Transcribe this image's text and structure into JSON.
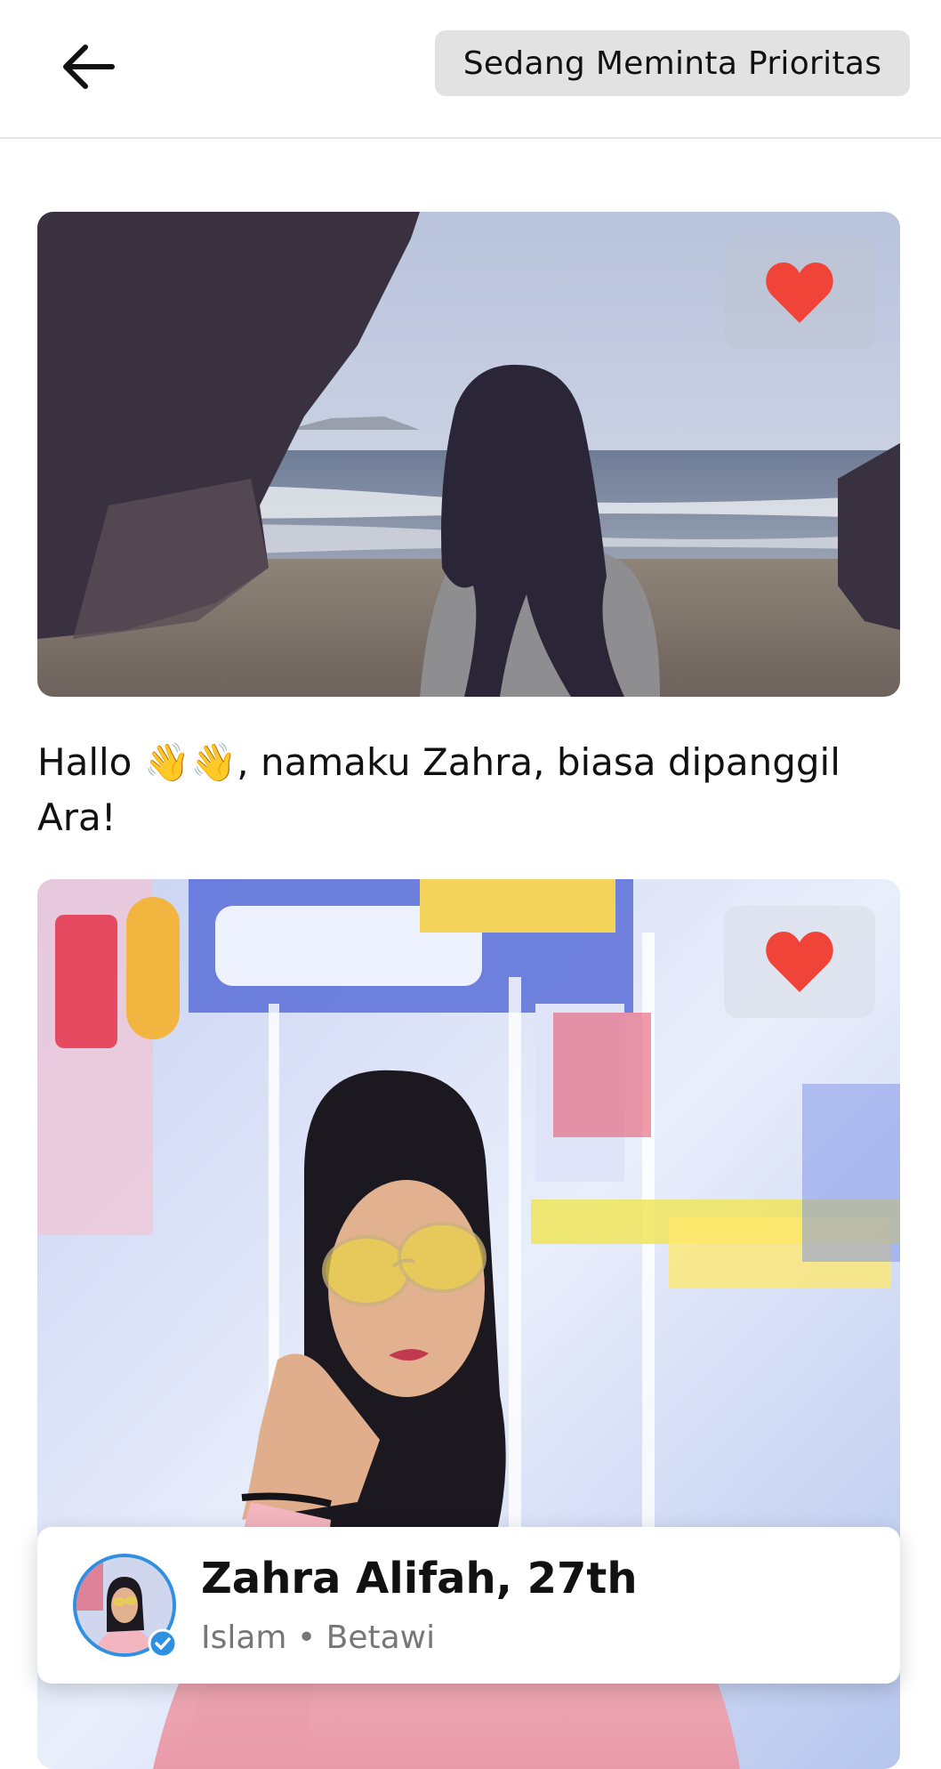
{
  "header": {
    "back_icon": "arrow-left-icon",
    "status_label": "Sedang Meminta Prioritas"
  },
  "photos": [
    {
      "description_icon": "photo",
      "liked": true,
      "like_icon": "heart-icon",
      "like_color": "#f04438"
    },
    {
      "description_icon": "photo",
      "liked": true,
      "like_icon": "heart-icon",
      "like_color": "#f04438"
    }
  ],
  "intro_text": "Hallo 👋👋, namaku Zahra, biasa dipanggil Ara!",
  "profile": {
    "name": "Zahra Alifah, 27th",
    "meta": "Islam • Betawi",
    "verified_icon": "verified-badge-icon",
    "accent_color": "#2f8fe0"
  }
}
